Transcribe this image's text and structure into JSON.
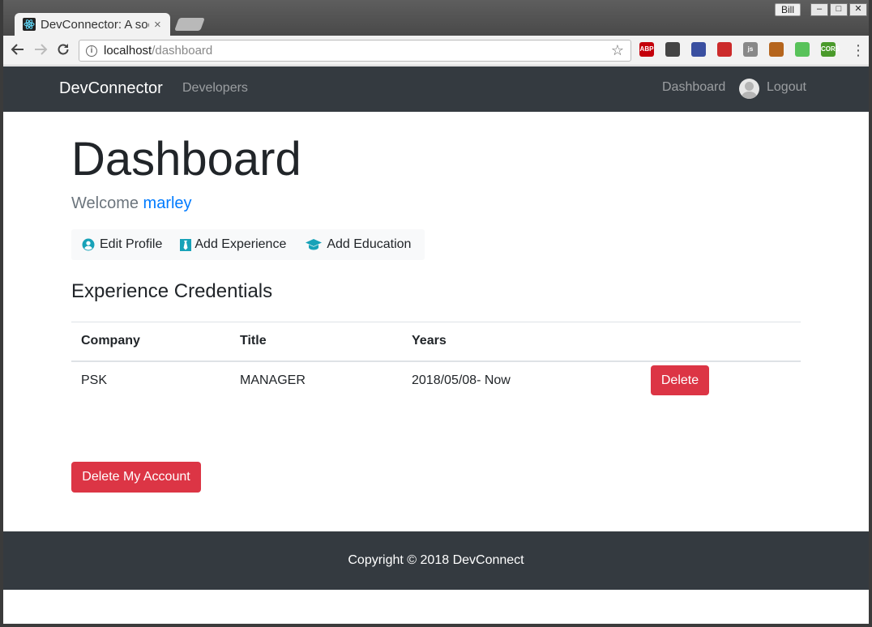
{
  "browser": {
    "tab_title": "DevConnector: A social network for developers",
    "tab_close": "×",
    "user_badge": "Bill",
    "window_buttons": [
      "–",
      "□",
      "✕"
    ],
    "url_host": "localhost",
    "url_path": "/dashboard",
    "extensions": [
      {
        "name": "adblock-icon",
        "label": "ABP",
        "color": "#c4000b"
      },
      {
        "name": "sync-icon",
        "label": "",
        "color": "#444444"
      },
      {
        "name": "extension-colorful-icon",
        "label": "",
        "color": "#3a4fa0"
      },
      {
        "name": "extension-red-icon",
        "label": "",
        "color": "#cc2b2b"
      },
      {
        "name": "js-icon",
        "label": "js",
        "color": "#888888"
      },
      {
        "name": "monkey-icon",
        "label": "",
        "color": "#b5651d"
      },
      {
        "name": "circle-extension-icon",
        "label": "",
        "color": "#58c25a"
      },
      {
        "name": "cors-icon",
        "label": "CORS",
        "color": "#4a9a2b"
      }
    ]
  },
  "navbar": {
    "brand": "DevConnector",
    "developers": "Developers",
    "dashboard": "Dashboard",
    "logout": "Logout"
  },
  "main": {
    "title": "Dashboard",
    "welcome_prefix": "Welcome ",
    "user_name": "marley",
    "actions": [
      {
        "label": "Edit Profile",
        "icon": "user-circle-icon"
      },
      {
        "label": "Add Experience",
        "icon": "black-tie-icon"
      },
      {
        "label": "Add Education",
        "icon": "graduation-cap-icon"
      }
    ],
    "experience_heading": "Experience Credentials",
    "table": {
      "headers": [
        "Company",
        "Title",
        "Years",
        ""
      ],
      "rows": [
        {
          "company": "PSK",
          "title": "MANAGER",
          "years": "2018/05/08- Now",
          "action": "Delete"
        }
      ]
    },
    "delete_account": "Delete My Account"
  },
  "footer": {
    "text": "Copyright © 2018 DevConnect"
  },
  "colors": {
    "navbar_bg": "#343a40",
    "danger": "#dc3545",
    "link": "#007bff",
    "info": "#17a2b8"
  }
}
